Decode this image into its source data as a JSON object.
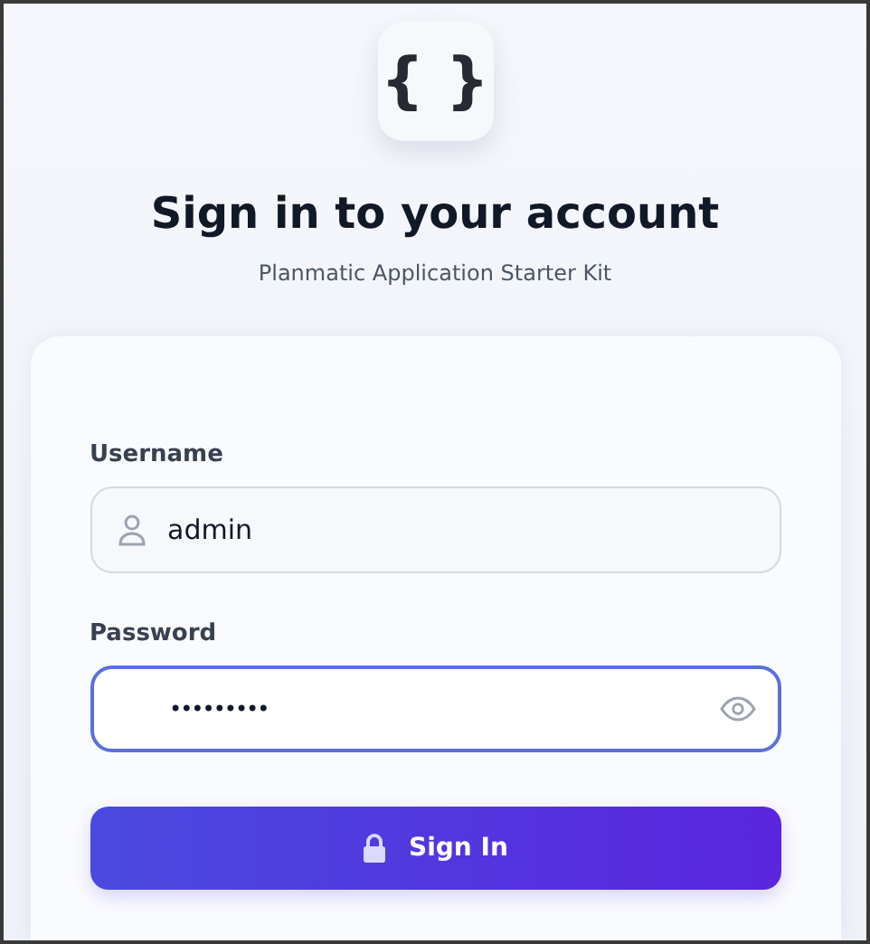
{
  "logo": {
    "glyph": "{ }"
  },
  "title": "Sign in to your account",
  "subtitle": "Planmatic Application Starter Kit",
  "form": {
    "fields": [
      {
        "kind": "text",
        "label": "Username",
        "value": "admin",
        "focused": false
      },
      {
        "kind": "password",
        "label": "Password",
        "value": "•••••••••",
        "focused": true
      }
    ],
    "submit": {
      "label": "Sign In"
    }
  }
}
